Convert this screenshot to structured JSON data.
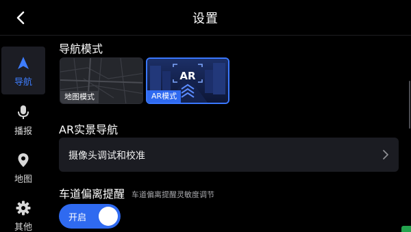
{
  "header": {
    "title": "设置",
    "back_icon": "back-arrow-icon"
  },
  "sidebar": {
    "items": [
      {
        "label": "导航",
        "icon": "navigation-arrow-icon",
        "active": true
      },
      {
        "label": "播报",
        "icon": "microphone-icon",
        "active": false
      },
      {
        "label": "地图",
        "icon": "map-pin-icon",
        "active": false
      },
      {
        "label": "其他",
        "icon": "gear-icon",
        "active": false
      }
    ]
  },
  "nav_mode": {
    "title": "导航模式",
    "options": [
      {
        "label": "地图模式",
        "selected": false
      },
      {
        "label": "AR模式",
        "selected": true,
        "overlay_text": "AR"
      }
    ]
  },
  "ar_nav": {
    "title": "AR实景导航",
    "row_label": "摄像头调试和校准"
  },
  "lane": {
    "title": "车道偏离提醒",
    "description": "车道偏离提醒灵敏度调节",
    "toggle_label": "开启",
    "toggle_on": true
  },
  "colors": {
    "accent": "#2f6af0",
    "background": "#000000",
    "card": "#1b1c22"
  }
}
